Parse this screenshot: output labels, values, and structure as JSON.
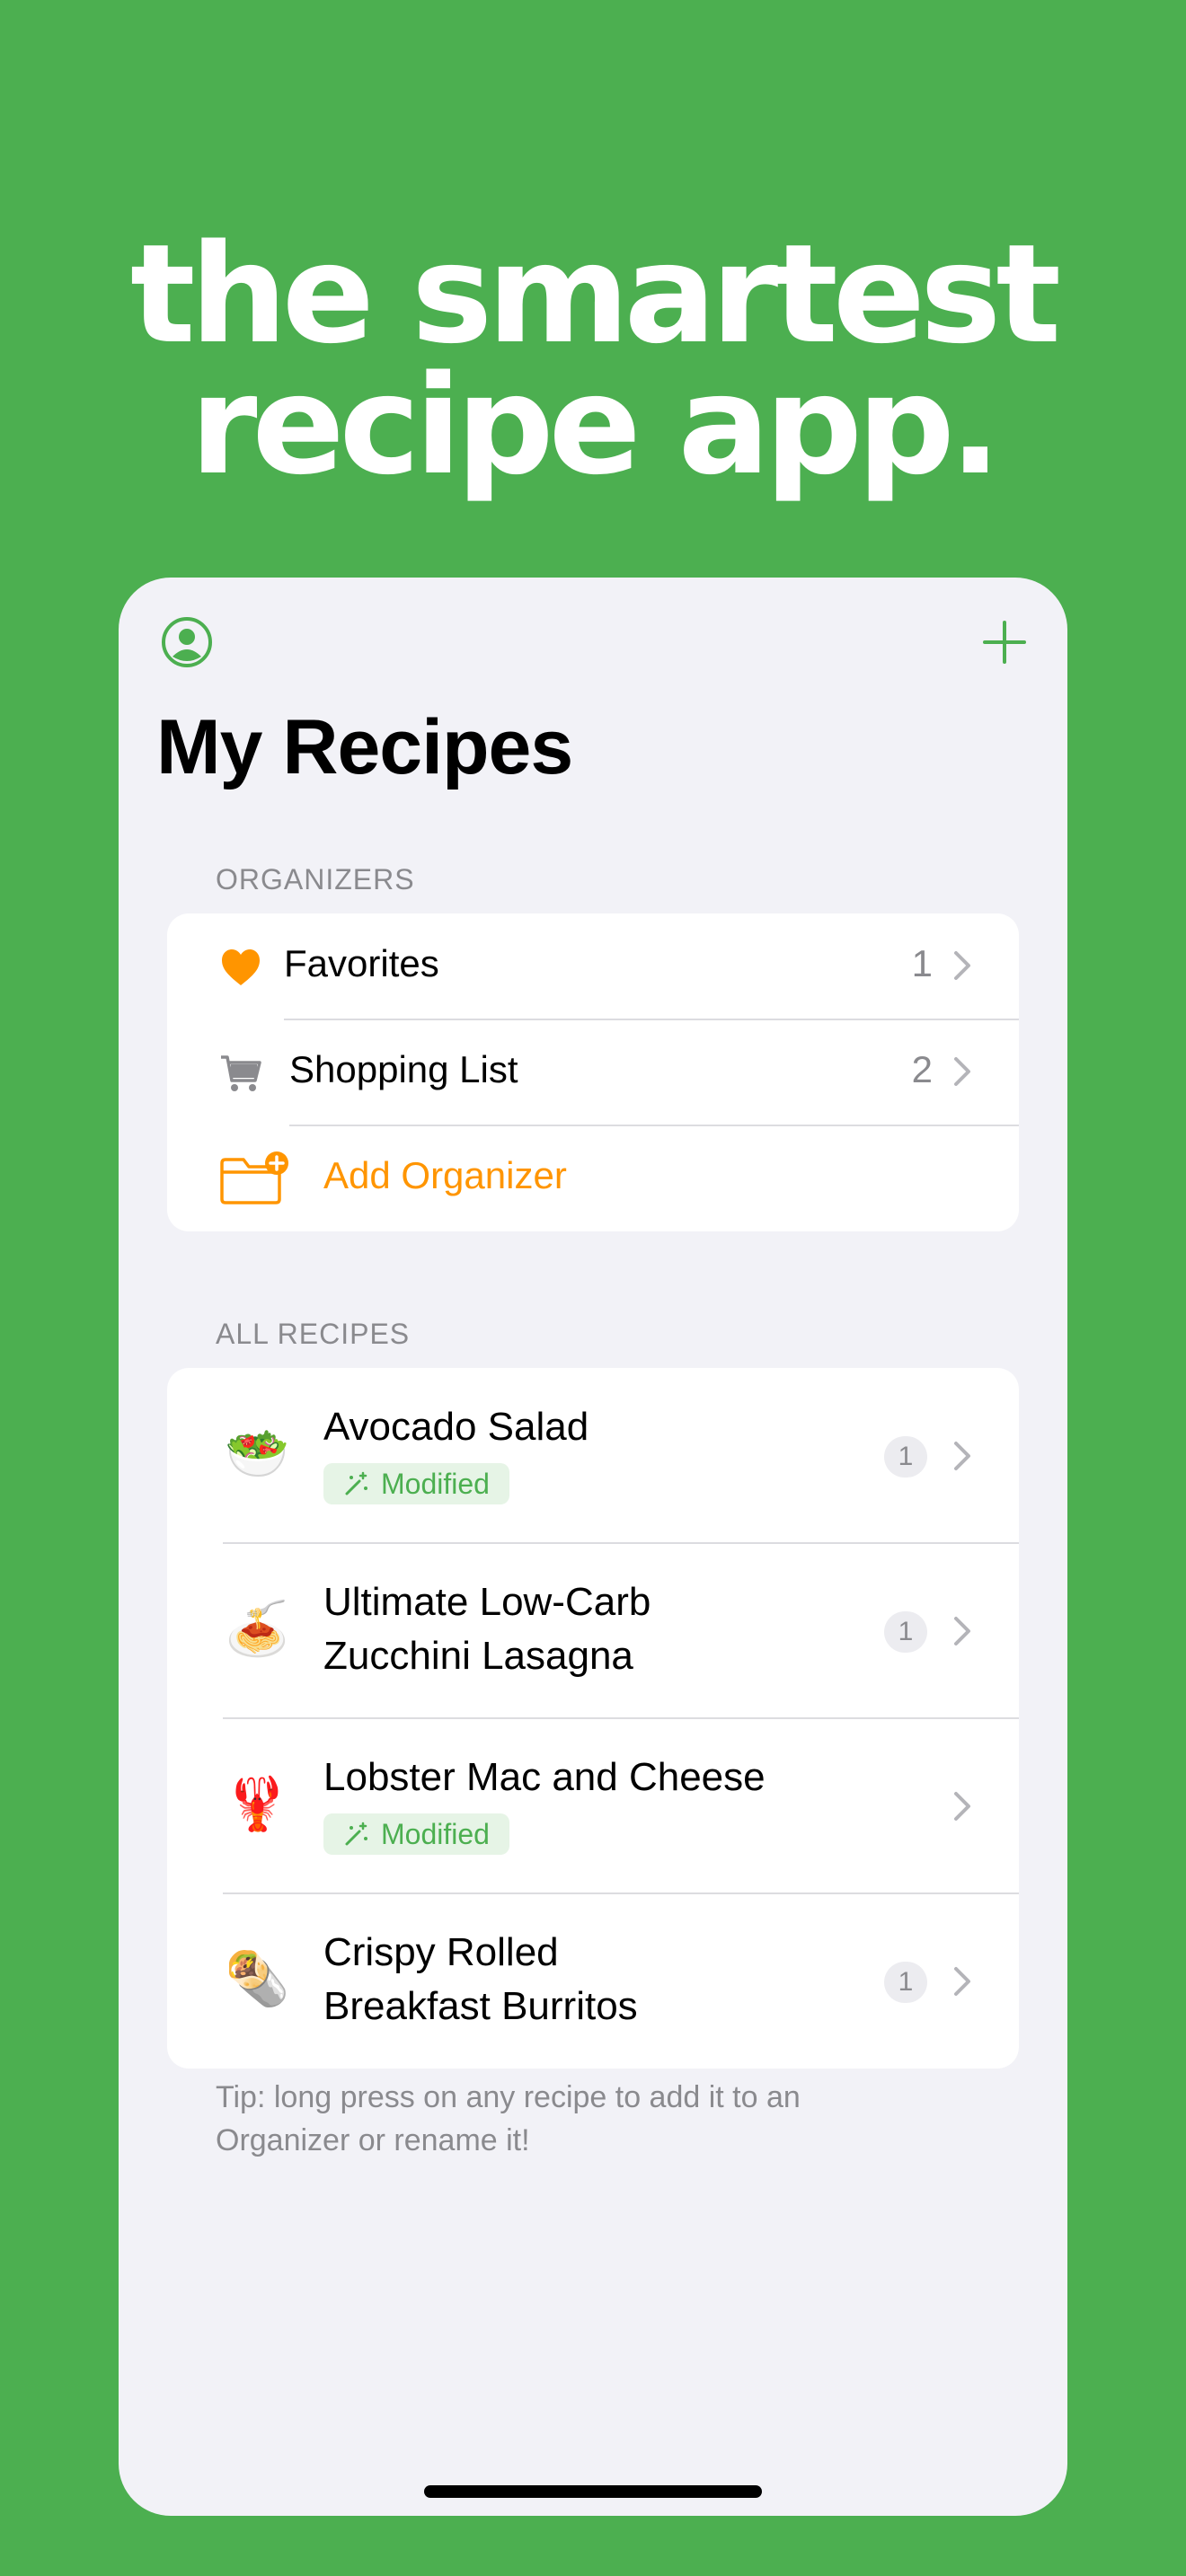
{
  "headline": {
    "line1": "the smartest",
    "line2": "recipe app."
  },
  "colors": {
    "background": "#4caf50",
    "accent": "#4caf50",
    "organizer_accent": "#ff9500",
    "badge_bg": "#e6f4e6"
  },
  "nav": {
    "profile_icon": "person-circle-icon",
    "add_icon": "plus-icon",
    "title": "My Recipes"
  },
  "organizers": {
    "header": "ORGANIZERS",
    "items": [
      {
        "icon": "heart-icon",
        "label": "Favorites",
        "count": "1"
      },
      {
        "icon": "cart-icon",
        "label": "Shopping List",
        "count": "2"
      }
    ],
    "add_label": "Add Organizer"
  },
  "recipes": {
    "header": "ALL RECIPES",
    "items": [
      {
        "emoji": "🥗",
        "name_line1": "Avocado Salad",
        "name_line2": "",
        "badge": "Modified",
        "count": "1"
      },
      {
        "emoji": "🍝",
        "name_line1": "Ultimate Low-Carb",
        "name_line2": "Zucchini Lasagna",
        "badge": "",
        "count": "1"
      },
      {
        "emoji": "🦞",
        "name_line1": "Lobster Mac and Cheese",
        "name_line2": "",
        "badge": "Modified",
        "count": ""
      },
      {
        "emoji": "🌯",
        "name_line1": "Crispy Rolled",
        "name_line2": "Breakfast Burritos",
        "badge": "",
        "count": "1"
      }
    ]
  },
  "tip": "Tip: long press on any recipe to add it to an Organizer or rename it!"
}
